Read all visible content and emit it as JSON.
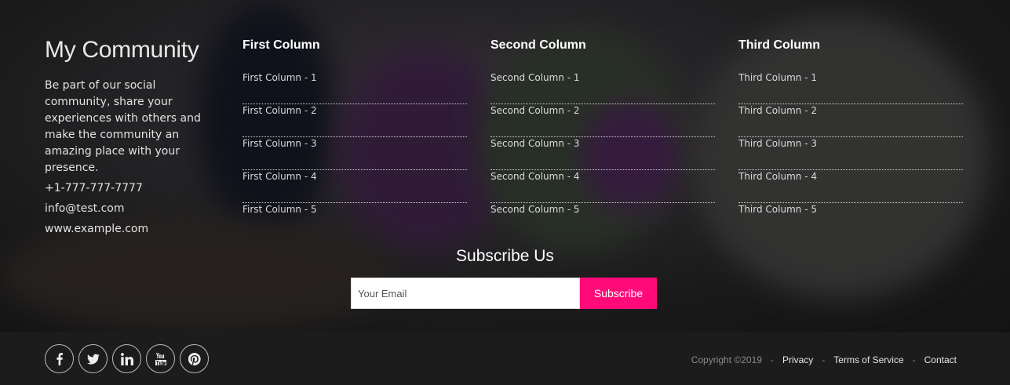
{
  "about": {
    "title": "My Community",
    "description": "Be part of our social community, share your experiences with others and make the community an amazing place with your presence.",
    "phone": "+1-777-777-7777",
    "email": "info@test.com",
    "website": "www.example.com"
  },
  "columns": [
    {
      "heading": "First Column",
      "items": [
        "First Column - 1",
        "First Column - 2",
        "First Column - 3",
        "First Column - 4",
        "First Column - 5"
      ]
    },
    {
      "heading": "Second Column",
      "items": [
        "Second Column - 1",
        "Second Column - 2",
        "Second Column - 3",
        "Second Column - 4",
        "Second Column - 5"
      ]
    },
    {
      "heading": "Third Column",
      "items": [
        "Third Column - 1",
        "Third Column - 2",
        "Third Column - 3",
        "Third Column - 4",
        "Third Column - 5"
      ]
    }
  ],
  "subscribe": {
    "title": "Subscribe Us",
    "placeholder": "Your Email",
    "value": "",
    "button_label": "Subscribe",
    "button_color": "#ff0a78"
  },
  "footer": {
    "socials": [
      "facebook-icon",
      "twitter-icon",
      "linkedin-icon",
      "youtube-icon",
      "pinterest-icon"
    ],
    "copyright": "Copyright ©2019",
    "separator": "-",
    "links": [
      "Privacy",
      "Terms of Service",
      "Contact"
    ]
  }
}
